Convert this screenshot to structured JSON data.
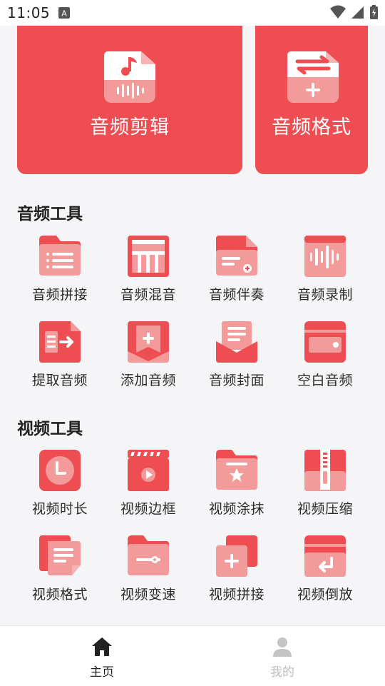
{
  "status_bar": {
    "time": "11:05"
  },
  "feature_cards": [
    {
      "label": "音频剪辑",
      "icon": "audio-edit-icon"
    },
    {
      "label": "音频格式",
      "icon": "audio-format-icon"
    }
  ],
  "audio_tools": {
    "title": "音频工具",
    "items": [
      {
        "label": "音频拼接",
        "icon": "folder-list-icon"
      },
      {
        "label": "音频混音",
        "icon": "mixer-icon"
      },
      {
        "label": "音频伴奏",
        "icon": "file-add-icon"
      },
      {
        "label": "音频录制",
        "icon": "waveform-icon"
      },
      {
        "label": "提取音频",
        "icon": "extract-arrow-icon"
      },
      {
        "label": "添加音频",
        "icon": "add-bookmark-icon"
      },
      {
        "label": "音频封面",
        "icon": "envelope-doc-icon"
      },
      {
        "label": "空白音频",
        "icon": "blank-box-icon"
      }
    ]
  },
  "video_tools": {
    "title": "视频工具",
    "items": [
      {
        "label": "视频时长",
        "icon": "clock-icon"
      },
      {
        "label": "视频边框",
        "icon": "clapper-play-icon"
      },
      {
        "label": "视频涂抹",
        "icon": "folder-star-icon"
      },
      {
        "label": "视频压缩",
        "icon": "zip-icon"
      },
      {
        "label": "视频格式",
        "icon": "doc-stack-icon"
      },
      {
        "label": "视频变速",
        "icon": "folder-slider-icon"
      },
      {
        "label": "视频拼接",
        "icon": "merge-plus-icon"
      },
      {
        "label": "视频倒放",
        "icon": "reverse-icon"
      }
    ]
  },
  "bottom_nav": {
    "tabs": [
      {
        "label": "主页",
        "icon": "home-icon",
        "active": true
      },
      {
        "label": "我的",
        "icon": "user-icon",
        "active": false
      }
    ]
  },
  "colors": {
    "accent": "#ee4e52",
    "accent_light": "#f39a9b",
    "background": "#f5f5f7"
  }
}
